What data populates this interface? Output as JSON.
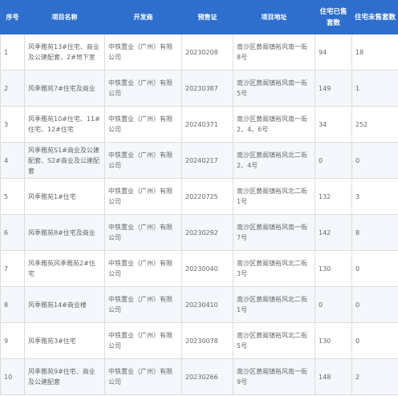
{
  "headers": {
    "no": "序号",
    "name": "项目名称",
    "developer": "开发商",
    "permit": "预售证",
    "address": "项目地址",
    "sold": "住宅已售套数",
    "unsold": "住宅未售套数"
  },
  "rows": [
    {
      "no": "1",
      "name": "风季雅苑13#住宅、商业及公建配套，2#地下室",
      "developer": "中铁置业（广州）有限公司",
      "permit": "20230208",
      "address": "南沙区黄阁镇裕风南一街8号",
      "sold": "94",
      "unsold": "18"
    },
    {
      "no": "2",
      "name": "风季雅苑7#住宅及商业",
      "developer": "中铁置业（广州）有限公司",
      "permit": "20230387",
      "address": "南沙区黄阁镇裕风南一街5号",
      "sold": "149",
      "unsold": "1"
    },
    {
      "no": "3",
      "name": "风季雅苑10#住宅、11#住宅、12#住宅",
      "developer": "中铁置业（广州）有限公司",
      "permit": "20240371",
      "address": "南沙区黄阁镇裕风南一街2、4、6号",
      "sold": "34",
      "unsold": "252"
    },
    {
      "no": "4",
      "name": "风季雅苑S1#商业及公建配套、S2#商业及公建配套",
      "developer": "中铁置业（广州）有限公司",
      "permit": "20240217",
      "address": "南沙区黄阁镇裕风北二街2、4号",
      "sold": "0",
      "unsold": "0"
    },
    {
      "no": "5",
      "name": "风季雅苑1#住宅",
      "developer": "中铁置业（广州）有限公司",
      "permit": "20220725",
      "address": "南沙区黄阁镇裕风北二街1号",
      "sold": "132",
      "unsold": "3"
    },
    {
      "no": "6",
      "name": "风季雅苑8#住宅及商业",
      "developer": "中铁置业（广州）有限公司",
      "permit": "20230292",
      "address": "南沙区黄阁镇裕风南一街7号",
      "sold": "142",
      "unsold": "8"
    },
    {
      "no": "7",
      "name": "风季雅苑风季雅苑2#住宅",
      "developer": "中铁置业（广州）有限公司",
      "permit": "20230040",
      "address": "南沙区黄阁镇裕风北二街3号",
      "sold": "130",
      "unsold": "0"
    },
    {
      "no": "8",
      "name": "风季雅苑14#商业楼",
      "developer": "中铁置业（广州）有限公司",
      "permit": "20230410",
      "address": "南沙区黄阁镇裕风北二街1号",
      "sold": "0",
      "unsold": "0"
    },
    {
      "no": "9",
      "name": "风季雅苑3#住宅",
      "developer": "中铁置业（广州）有限公司",
      "permit": "20230078",
      "address": "南沙区黄阁镇裕风北二街5号",
      "sold": "130",
      "unsold": "0"
    },
    {
      "no": "10",
      "name": "风季雅苑9#住宅、商业及公建配套",
      "developer": "中铁置业（广州）有限公司",
      "permit": "20230266",
      "address": "南沙区黄阁镇裕风南一街9号",
      "sold": "148",
      "unsold": "2"
    }
  ]
}
